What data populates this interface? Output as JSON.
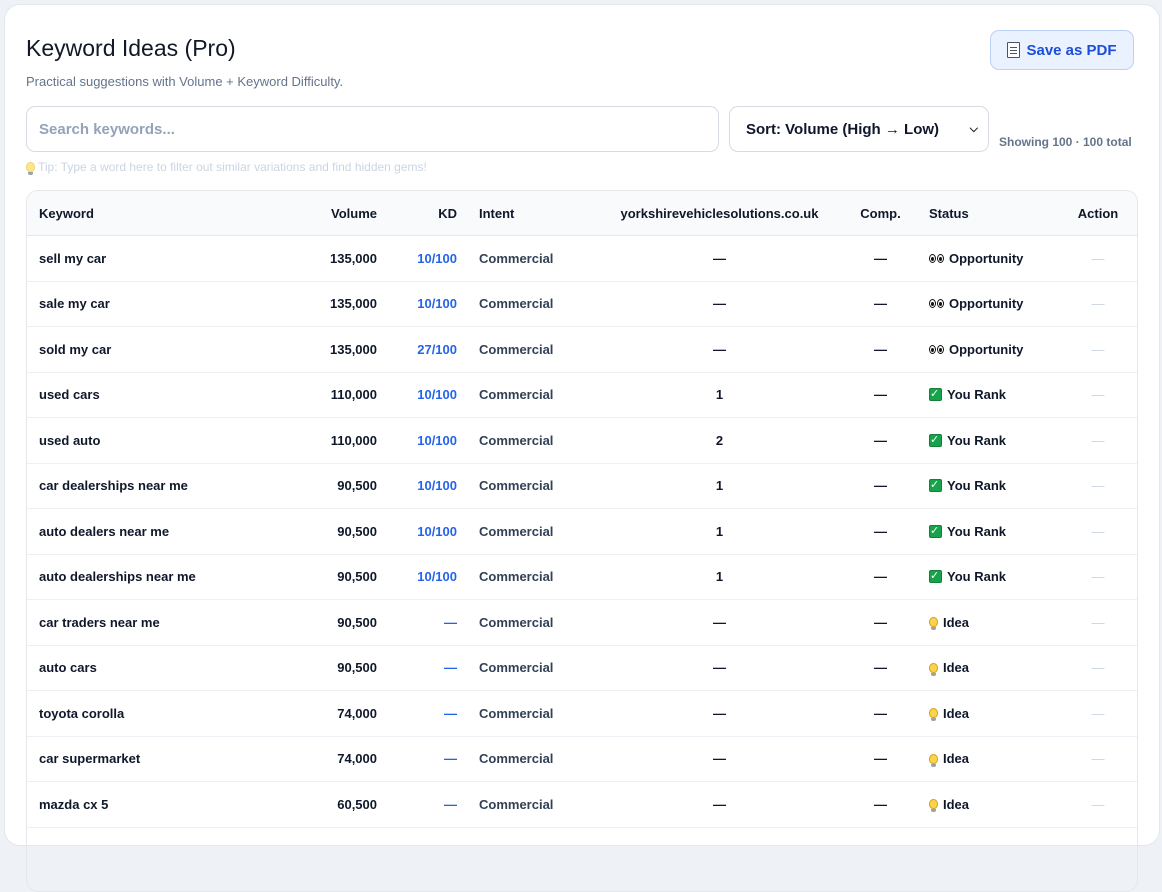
{
  "header": {
    "title": "Keyword Ideas (Pro)",
    "subtitle": "Practical suggestions with Volume + Keyword Difficulty.",
    "pdf_button_label": "Save as PDF"
  },
  "controls": {
    "search_placeholder": "Search keywords...",
    "search_value": "",
    "sort_label": "Sort: Volume (High → Low)",
    "showing_text": "Showing 100 · 100 total",
    "tip_text": "Tip: Type a word here to filter out similar variations and find hidden gems!"
  },
  "table": {
    "columns": [
      "Keyword",
      "Volume",
      "KD",
      "Intent",
      "yorkshirevehiclesolutions.co.uk",
      "Comp.",
      "Status",
      "Action"
    ],
    "rows": [
      {
        "keyword": "sell my car",
        "volume": "135,000",
        "kd": "10/100",
        "intent": "Commercial",
        "rank": "—",
        "comp": "—",
        "status": "Opportunity",
        "status_icon": "eyes-icon",
        "action": "—"
      },
      {
        "keyword": "sale my car",
        "volume": "135,000",
        "kd": "10/100",
        "intent": "Commercial",
        "rank": "—",
        "comp": "—",
        "status": "Opportunity",
        "status_icon": "eyes-icon",
        "action": "—"
      },
      {
        "keyword": "sold my car",
        "volume": "135,000",
        "kd": "27/100",
        "intent": "Commercial",
        "rank": "—",
        "comp": "—",
        "status": "Opportunity",
        "status_icon": "eyes-icon",
        "action": "—"
      },
      {
        "keyword": "used cars",
        "volume": "110,000",
        "kd": "10/100",
        "intent": "Commercial",
        "rank": "1",
        "comp": "—",
        "status": "You Rank",
        "status_icon": "check-icon",
        "action": "—"
      },
      {
        "keyword": "used auto",
        "volume": "110,000",
        "kd": "10/100",
        "intent": "Commercial",
        "rank": "2",
        "comp": "—",
        "status": "You Rank",
        "status_icon": "check-icon",
        "action": "—"
      },
      {
        "keyword": "car dealerships near me",
        "volume": "90,500",
        "kd": "10/100",
        "intent": "Commercial",
        "rank": "1",
        "comp": "—",
        "status": "You Rank",
        "status_icon": "check-icon",
        "action": "—"
      },
      {
        "keyword": "auto dealers near me",
        "volume": "90,500",
        "kd": "10/100",
        "intent": "Commercial",
        "rank": "1",
        "comp": "—",
        "status": "You Rank",
        "status_icon": "check-icon",
        "action": "—"
      },
      {
        "keyword": "auto dealerships near me",
        "volume": "90,500",
        "kd": "10/100",
        "intent": "Commercial",
        "rank": "1",
        "comp": "—",
        "status": "You Rank",
        "status_icon": "check-icon",
        "action": "—"
      },
      {
        "keyword": "car traders near me",
        "volume": "90,500",
        "kd": "—",
        "intent": "Commercial",
        "rank": "—",
        "comp": "—",
        "status": "Idea",
        "status_icon": "bulb-icon",
        "action": "—"
      },
      {
        "keyword": "auto cars",
        "volume": "90,500",
        "kd": "—",
        "intent": "Commercial",
        "rank": "—",
        "comp": "—",
        "status": "Idea",
        "status_icon": "bulb-icon",
        "action": "—"
      },
      {
        "keyword": "toyota corolla",
        "volume": "74,000",
        "kd": "—",
        "intent": "Commercial",
        "rank": "—",
        "comp": "—",
        "status": "Idea",
        "status_icon": "bulb-icon",
        "action": "—"
      },
      {
        "keyword": "car supermarket",
        "volume": "74,000",
        "kd": "—",
        "intent": "Commercial",
        "rank": "—",
        "comp": "—",
        "status": "Idea",
        "status_icon": "bulb-icon",
        "action": "—"
      },
      {
        "keyword": "mazda cx 5",
        "volume": "60,500",
        "kd": "—",
        "intent": "Commercial",
        "rank": "—",
        "comp": "—",
        "status": "Idea",
        "status_icon": "bulb-icon",
        "action": "—"
      }
    ]
  }
}
